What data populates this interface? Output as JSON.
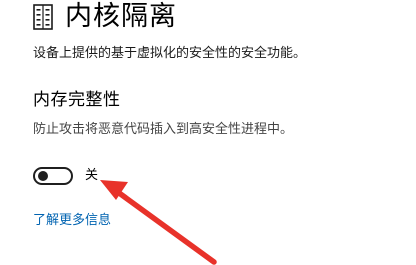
{
  "header": {
    "icon": "core-isolation-icon",
    "title": "内核隔离"
  },
  "page_description": "设备上提供的基于虚拟化的安全性的安全功能。",
  "memory_integrity": {
    "title": "内存完整性",
    "description": "防止攻击将恶意代码插入到高安全性进程中。",
    "toggle_state": "关",
    "toggle_on": false
  },
  "learn_more_link": "了解更多信息",
  "colors": {
    "link": "#0063b1",
    "annotation_arrow": "#e8322a",
    "toggle": "#1f1f1f"
  }
}
